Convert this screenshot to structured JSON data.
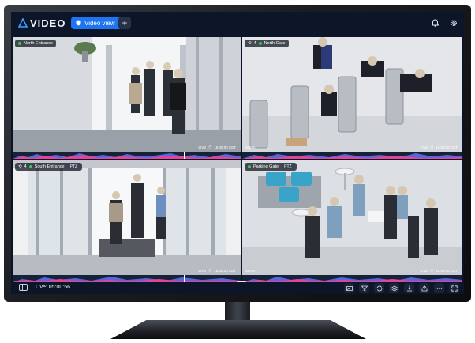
{
  "app": {
    "logo_text": "VIDEO",
    "logo_icon": "triangle-logo-icon"
  },
  "header": {
    "tab_label": "Video view",
    "tab_icon": "shield-icon",
    "add_tab_icon": "plus-icon",
    "add_tab_symbol": "+",
    "right_icons": [
      "bell-icon",
      "gear-icon"
    ]
  },
  "cameras": [
    {
      "name": "North Entrance",
      "status": "online",
      "sync_count": "",
      "ptz": "",
      "zoom": "",
      "live_text": "LIVE",
      "timestamp": "16:00:00 CET"
    },
    {
      "name": "North Gate",
      "status": "online",
      "sync_count": "4",
      "ptz": "",
      "zoom": "40mm",
      "live_text": "LIVE",
      "timestamp": "16:00:00 CET"
    },
    {
      "name": "South Entrance",
      "status": "online",
      "sync_count": "4",
      "ptz": "PTZ",
      "zoom": "",
      "live_text": "LIVE",
      "timestamp": "16:00:00 CET"
    },
    {
      "name": "Parking Gate",
      "status": "online",
      "sync_count": "",
      "ptz": "PTZ",
      "zoom": "35mm",
      "live_text": "LIVE",
      "timestamp": "16:00:00 CET"
    }
  ],
  "footer": {
    "live_label": "Live: 05:00:56",
    "layout_icon": "layout-panel-icon",
    "actions": [
      "image-icon",
      "filter-icon",
      "sync-icon",
      "layers-icon",
      "download-icon",
      "share-icon",
      "more-icon",
      "fullscreen-icon"
    ]
  },
  "colors": {
    "accent": "#1f74f0",
    "online": "#34c759",
    "bar_bg": "#0c1628",
    "timeline_pink": "#e0459a",
    "timeline_blue": "#5b6ff0"
  }
}
